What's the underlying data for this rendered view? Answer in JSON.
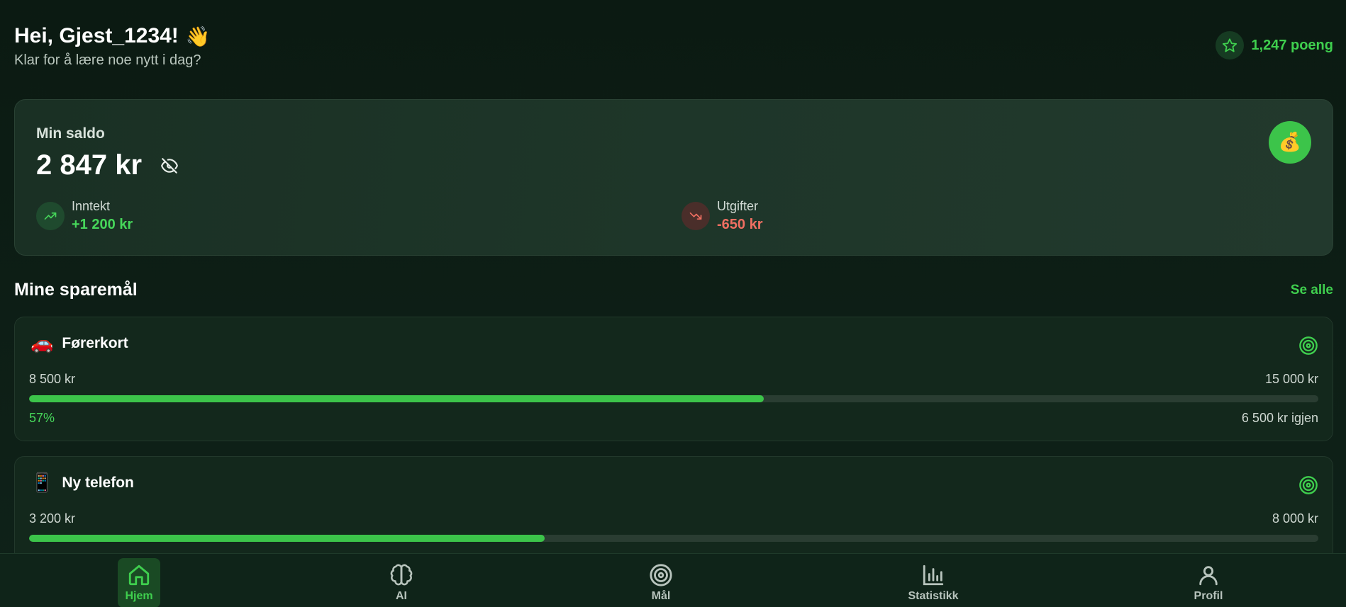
{
  "header": {
    "greeting": "Hei, Gjest_1234!",
    "wave_emoji": "👋",
    "subtitle": "Klar for å lære noe nytt i dag?",
    "points": "1,247 poeng"
  },
  "balance": {
    "label": "Min saldo",
    "amount": "2 847 kr",
    "icon": "money-bag",
    "income": {
      "label": "Inntekt",
      "value": "+1 200 kr"
    },
    "expense": {
      "label": "Utgifter",
      "value": "-650 kr"
    }
  },
  "goals_section": {
    "title": "Mine sparemål",
    "see_all": "Se alle",
    "goals": [
      {
        "emoji": "🚗",
        "name": "Førerkort",
        "saved": "8 500 kr",
        "target": "15 000 kr",
        "percent_label": "57%",
        "progress": 0.57,
        "left": "6 500 kr igjen"
      },
      {
        "emoji": "📱",
        "name": "Ny telefon",
        "saved": "3 200 kr",
        "target": "8 000 kr",
        "progress": 0.4
      }
    ]
  },
  "nav": {
    "items": [
      {
        "label": "Hjem",
        "icon": "home-icon",
        "active": true
      },
      {
        "label": "AI",
        "icon": "brain-icon",
        "active": false
      },
      {
        "label": "Mål",
        "icon": "target-icon",
        "active": false
      },
      {
        "label": "Statistikk",
        "icon": "bar-chart-icon",
        "active": false
      },
      {
        "label": "Profil",
        "icon": "user-icon",
        "active": false
      }
    ]
  },
  "colors": {
    "accent": "#3cc44a",
    "income": "#46d65a",
    "expense": "#ef6f62",
    "background": "#0c1c14"
  }
}
